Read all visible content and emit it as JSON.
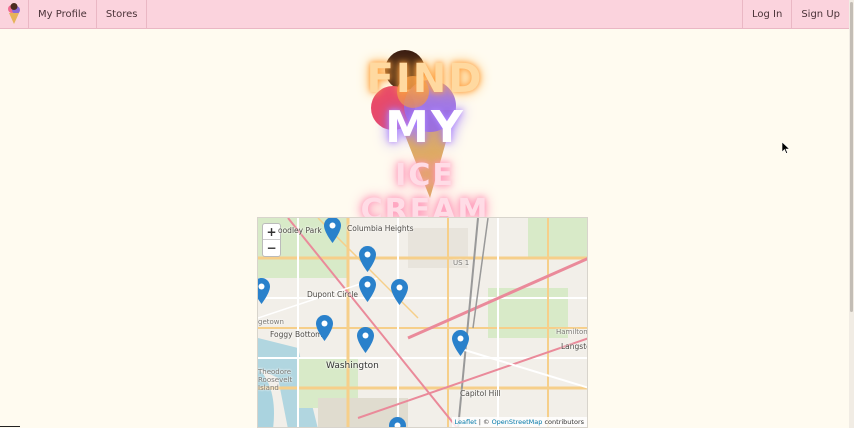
{
  "nav": {
    "profile_label": "My Profile",
    "stores_label": "Stores",
    "login_label": "Log In",
    "signup_label": "Sign Up"
  },
  "hero": {
    "line1": "FIND",
    "line2": "MY",
    "line3": "ICE CREAM"
  },
  "map": {
    "zoom_in": "+",
    "zoom_out": "−",
    "labels": {
      "woodley_park": "oodley Park",
      "columbia_heights": "Columbia Heights",
      "dupont_circle": "Dupont Circle",
      "georgetown": "getown",
      "foggy_bottom": "Foggy Bottom",
      "washington": "Washington",
      "capitol_hill": "Capitol Hill",
      "us1": "US 1",
      "langston": "Langsto",
      "hamilton": "Hamilton",
      "theodore": "Theodore Roosevelt Island"
    },
    "attribution": {
      "leaflet": "Leaflet",
      "separator": " | © ",
      "osm": "OpenStreetMap",
      "suffix": " contributors"
    }
  },
  "colors": {
    "navbar": "#fbd3dd",
    "page_bg": "#fffbf0",
    "marker_blue": "#2a81cb"
  }
}
